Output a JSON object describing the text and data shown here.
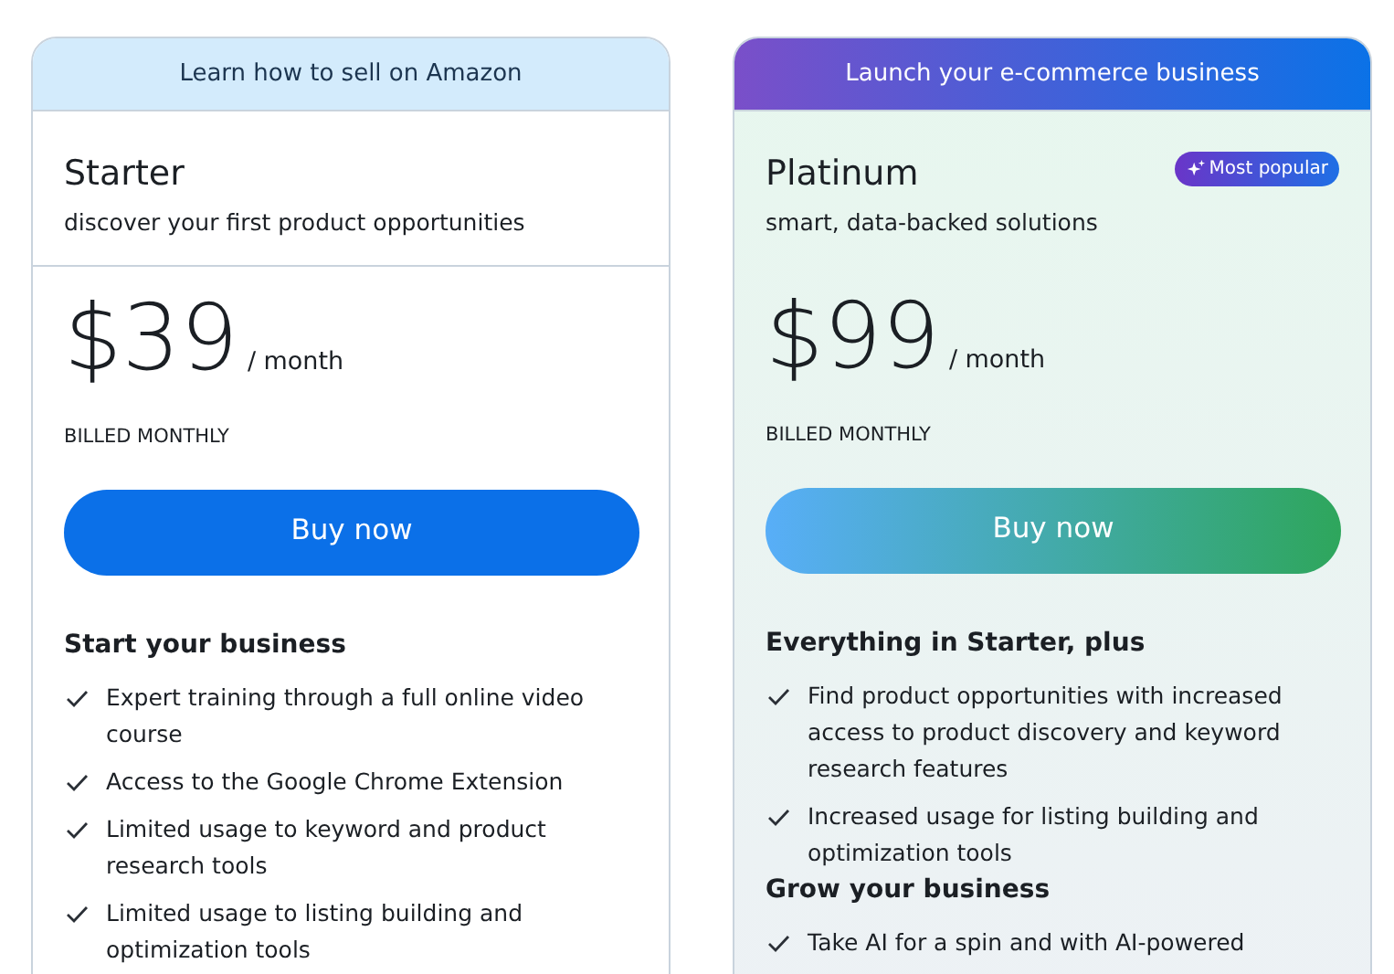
{
  "plans": [
    {
      "kind": "standard",
      "banner": "Learn how to sell on Amazon",
      "name": "Starter",
      "tagline": "discover your first product opportunities",
      "price": "$39",
      "period": "/ month",
      "billing": "BILLED MONTHLY",
      "button": "Buy now",
      "sections": [
        {
          "heading": "Start your business",
          "items": [
            "Expert training through a full online video course",
            "Access to the Google Chrome Extension",
            "Limited usage to keyword and product research tools",
            "Limited usage to listing building and optimization tools"
          ]
        }
      ]
    },
    {
      "kind": "featured",
      "banner": "Launch your e-commerce business",
      "badge": "Most popular",
      "name": "Platinum",
      "tagline": "smart, data-backed solutions",
      "price": "$99",
      "period": "/ month",
      "billing": "BILLED MONTHLY",
      "button": "Buy now",
      "sections": [
        {
          "heading": "Everything in Starter, plus",
          "items": [
            "Find product opportunities with increased access to product discovery and keyword research features",
            "Increased usage for listing building and optimization tools"
          ]
        },
        {
          "heading": "Grow your business",
          "items": [
            "Take AI for a spin and with AI-powered"
          ]
        }
      ]
    }
  ]
}
